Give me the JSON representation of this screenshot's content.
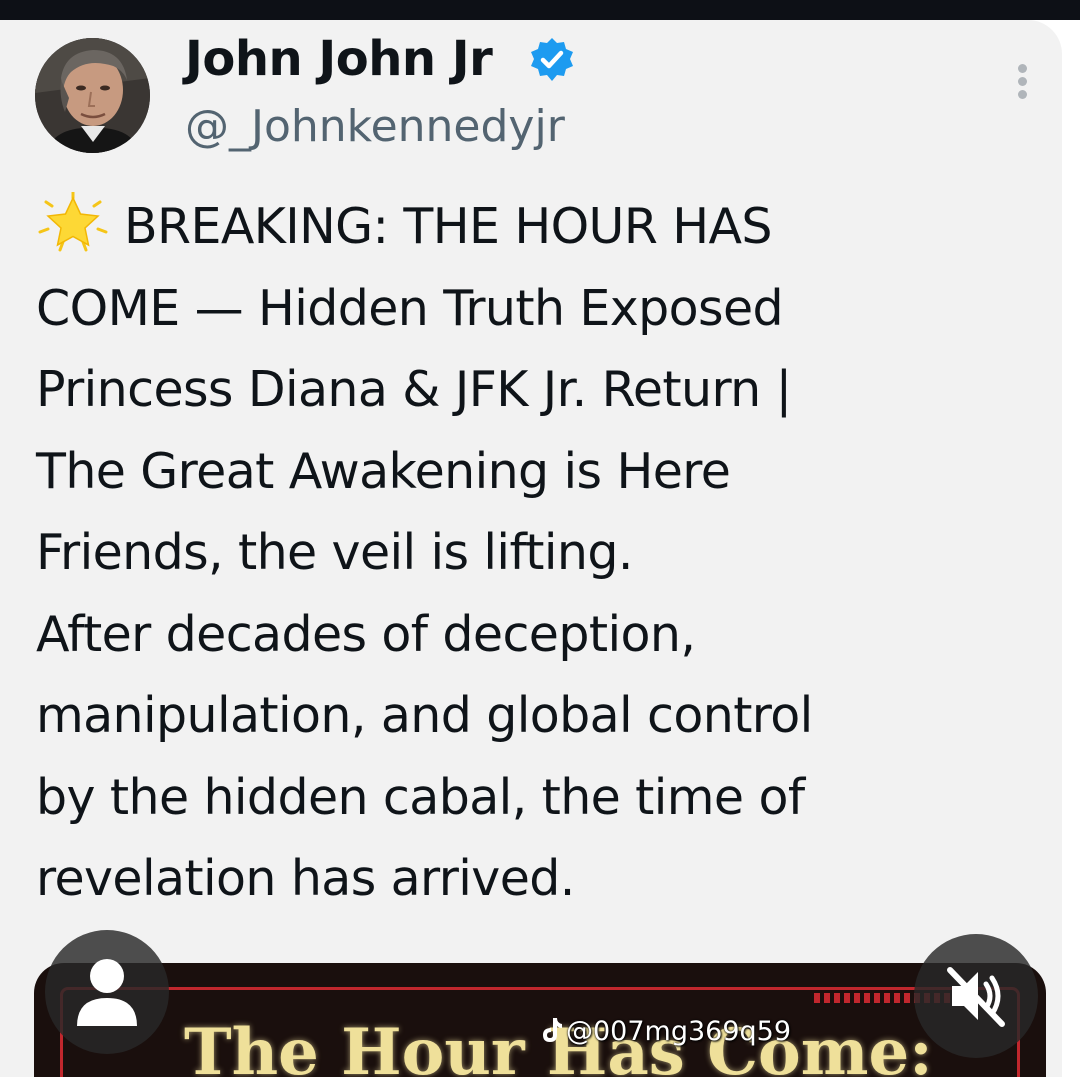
{
  "author": {
    "display_name": "John John Jr",
    "handle": "@_Johnkennedyjr",
    "verified": true,
    "avatar_icon": "profile-photo"
  },
  "tweet": {
    "lines": [
      "BREAKING: THE HOUR HAS",
      "COME — Hidden Truth Exposed",
      "Princess Diana & JFK Jr. Return |",
      "The Great Awakening is Here",
      "Friends, the veil is lifting.",
      "After decades of deception,",
      "manipulation, and global control",
      "by the hidden cabal, the time of",
      "revelation has arrived."
    ],
    "leading_icon": "star-emoji"
  },
  "media": {
    "title_text": "The Hour Has Come:"
  },
  "overlay": {
    "watermark": "@007mg369q59",
    "watermark_icon": "tiktok-icon",
    "profile_icon": "user-icon",
    "mute_icon": "muted-speaker-icon"
  },
  "colors": {
    "background": "#f2f2f2",
    "text": "#0f1419",
    "handle": "#536471",
    "verified_blue": "#1d9bf0",
    "media_red": "#c1272d",
    "media_title": "#efe09a"
  }
}
